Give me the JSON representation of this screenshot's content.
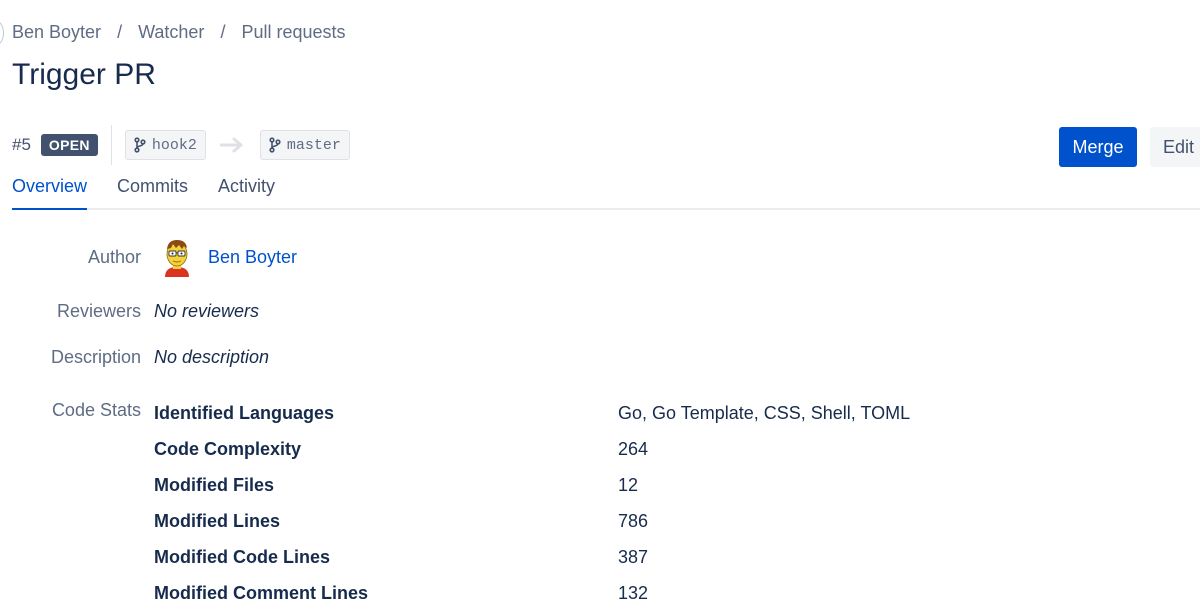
{
  "breadcrumb": {
    "project": "Ben Boyter",
    "repo": "Watcher",
    "section": "Pull requests",
    "separator": "/"
  },
  "pr": {
    "title": "Trigger PR",
    "number": "#5",
    "status": "OPEN",
    "source_branch": "hook2",
    "target_branch": "master"
  },
  "actions": {
    "merge_label": "Merge",
    "edit_label": "Edit"
  },
  "tabs": [
    {
      "label": "Overview"
    },
    {
      "label": "Commits"
    },
    {
      "label": "Activity"
    }
  ],
  "details": {
    "author_label": "Author",
    "author_name": "Ben Boyter",
    "reviewers_label": "Reviewers",
    "reviewers_value": "No reviewers",
    "description_label": "Description",
    "description_value": "No description",
    "code_stats_label": "Code Stats"
  },
  "code_stats": [
    {
      "name": "Identified Languages",
      "value": "Go, Go Template, CSS, Shell, TOML"
    },
    {
      "name": "Code Complexity",
      "value": "264"
    },
    {
      "name": "Modified Files",
      "value": "12"
    },
    {
      "name": "Modified Lines",
      "value": "786"
    },
    {
      "name": "Modified Code Lines",
      "value": "387"
    },
    {
      "name": "Modified Comment Lines",
      "value": "132"
    }
  ],
  "colors": {
    "accent": "#0052cc",
    "status_badge": "#42526e",
    "text": "#172b4d",
    "muted": "#5e6c84"
  },
  "icons": {
    "branch": "branch-icon",
    "arrow": "arrow-right-icon"
  }
}
